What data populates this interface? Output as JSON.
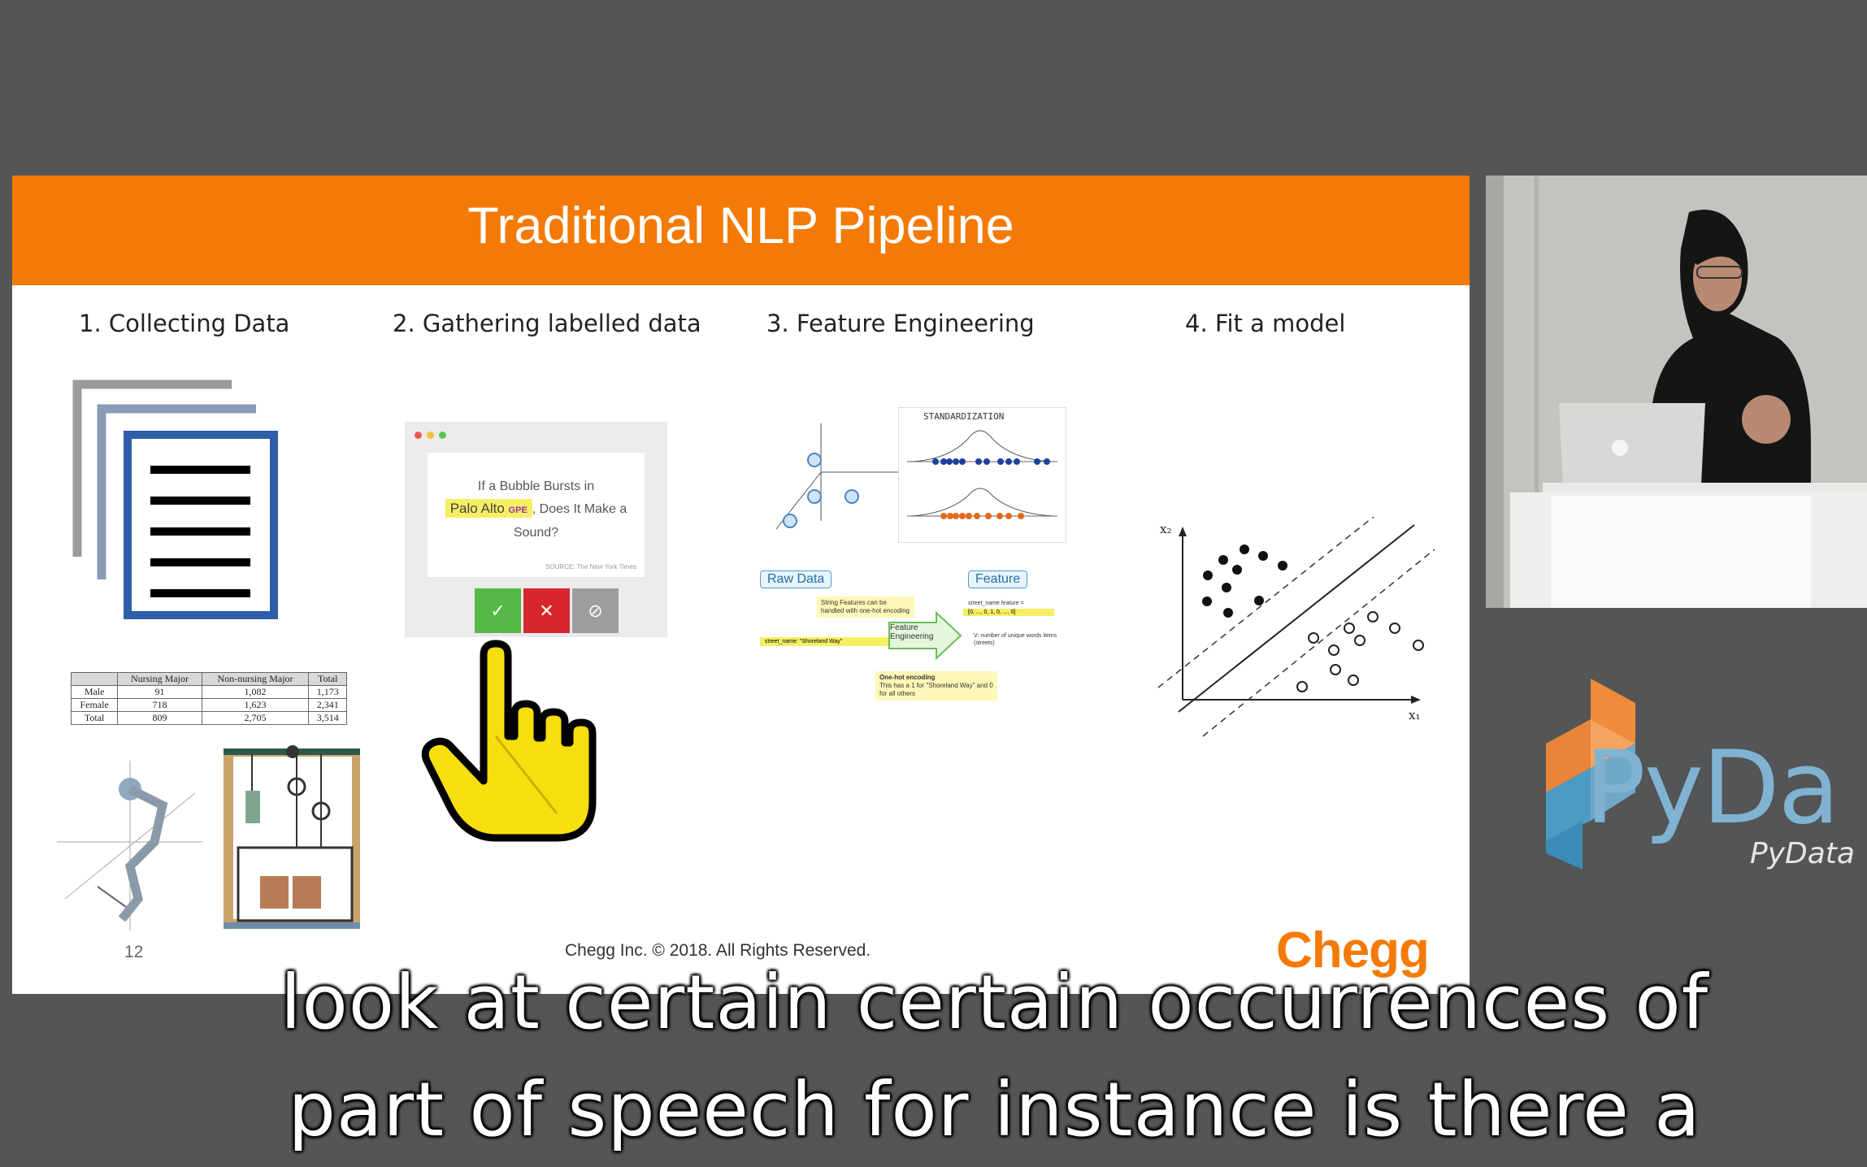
{
  "slide": {
    "title": "Traditional NLP Pipeline",
    "columns": [
      {
        "heading": "1. Collecting Data"
      },
      {
        "heading": "2. Gathering labelled data"
      },
      {
        "heading": "3. Feature Engineering"
      },
      {
        "heading": "4. Fit a model"
      }
    ],
    "table": {
      "headers": [
        "",
        "Nursing Major",
        "Non-nursing Major",
        "Total"
      ],
      "rows": [
        [
          "Male",
          "91",
          "1,082",
          "1,173"
        ],
        [
          "Female",
          "718",
          "1,623",
          "2,341"
        ],
        [
          "Total",
          "809",
          "2,705",
          "3,514"
        ]
      ]
    },
    "labeling_card": {
      "text_before": "If a Bubble Bursts in",
      "entity": "Palo Alto",
      "entity_label": "GPE",
      "text_after": ", Does It Make a",
      "text_end": "Sound?",
      "source": "SOURCE: The New York Times"
    },
    "feature_panel": {
      "chart_title": "STANDARDIZATION",
      "raw_label": "Raw Data",
      "feature_label": "Feature",
      "engineering_label": "Feature Engineering",
      "note_strings": "String Features can be handled with one-hot encoding",
      "note_onehot": "One-hot encoding",
      "note_onehot_body": "This has a 1 for \"Shoreland Way\" and 0 for all others",
      "raw_value": "street_name: \"Shoreland Way\"",
      "feature_value": "street_name feature =",
      "feature_vector": "[0, ..., 0, 1, 0, ..., 0]",
      "feature_note": "V: number of unique words items (streets)"
    },
    "svm": {
      "x_label": "x₁",
      "y_label": "x₂"
    },
    "page_number": "12",
    "footer": "Chegg Inc. © 2018. All Rights Reserved.",
    "logo": "Chegg"
  },
  "branding": {
    "big": "PyDa",
    "small": "PyData"
  },
  "caption": {
    "line1": "look at certain certain occurrences of",
    "line2": "part of speech for instance is there a"
  },
  "colors": {
    "accent": "#f37a06",
    "background": "#545556",
    "doc_blue": "#2e5ea8"
  }
}
